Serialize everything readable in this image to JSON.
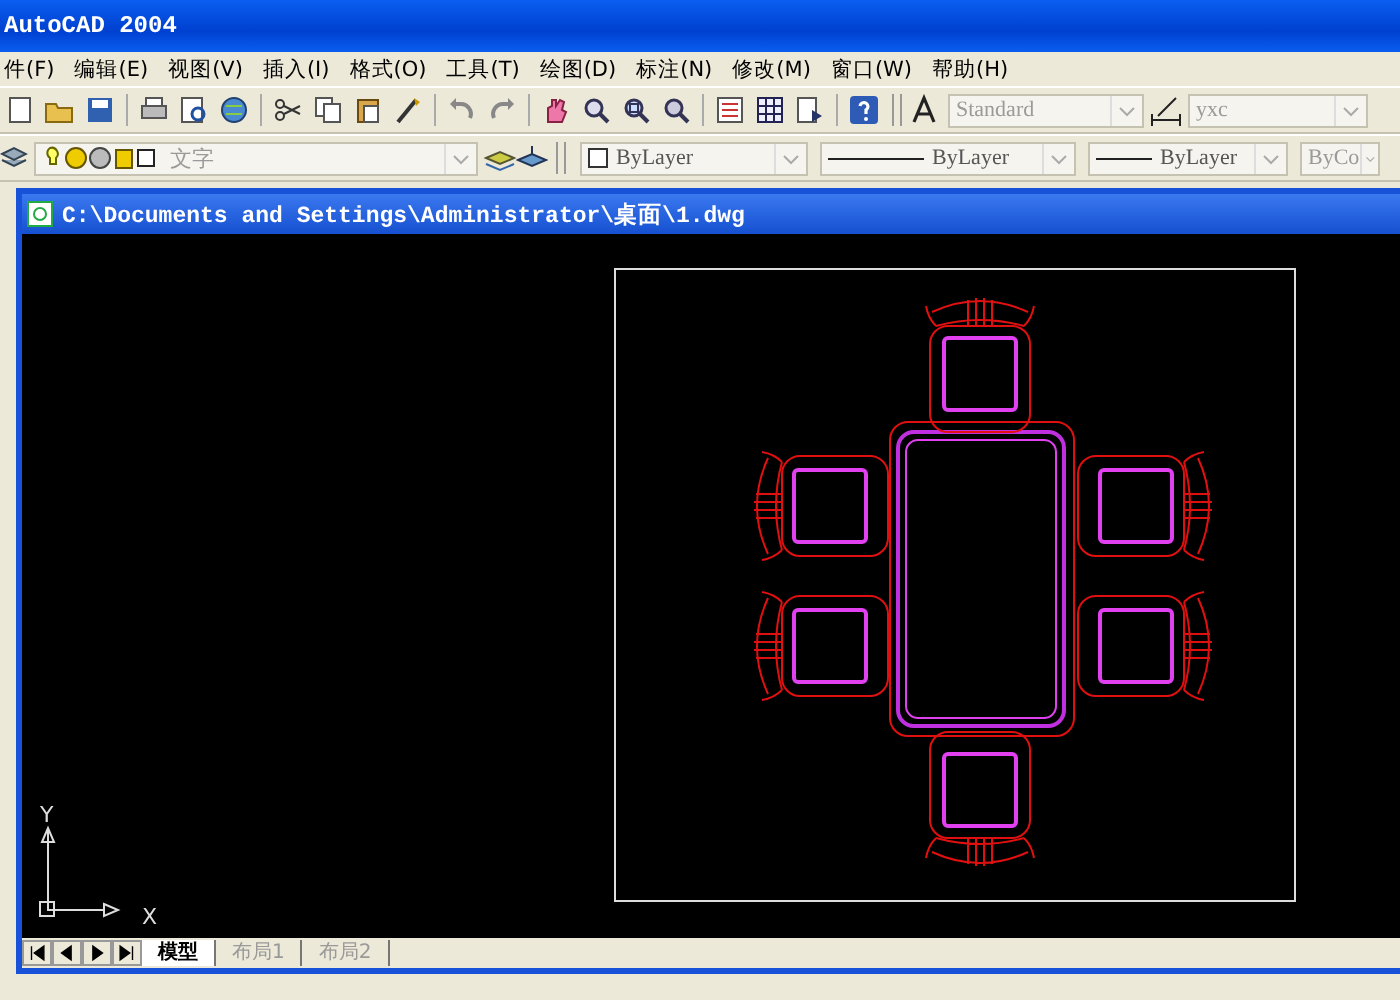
{
  "app_title": "AutoCAD 2004",
  "menu": [
    "件(F)",
    "编辑(E)",
    "视图(V)",
    "插入(I)",
    "格式(O)",
    "工具(T)",
    "绘图(D)",
    "标注(N)",
    "修改(M)",
    "窗口(W)",
    "帮助(H)"
  ],
  "toolbar": {
    "text_style": "Standard",
    "dim_style": "yxc"
  },
  "layer_bar": {
    "layer": "文字",
    "color_control": "ByLayer",
    "linetype": "ByLayer",
    "lineweight": "ByLayer",
    "plot_style": "ByCo"
  },
  "document": {
    "title": "C:\\Documents and Settings\\Administrator\\桌面\\1.dwg",
    "axis_x": "X",
    "axis_y": "Y",
    "tabs": [
      {
        "label": "模型",
        "selected": true
      },
      {
        "label": "布局1",
        "selected": false
      },
      {
        "label": "布局2",
        "selected": false
      }
    ]
  }
}
